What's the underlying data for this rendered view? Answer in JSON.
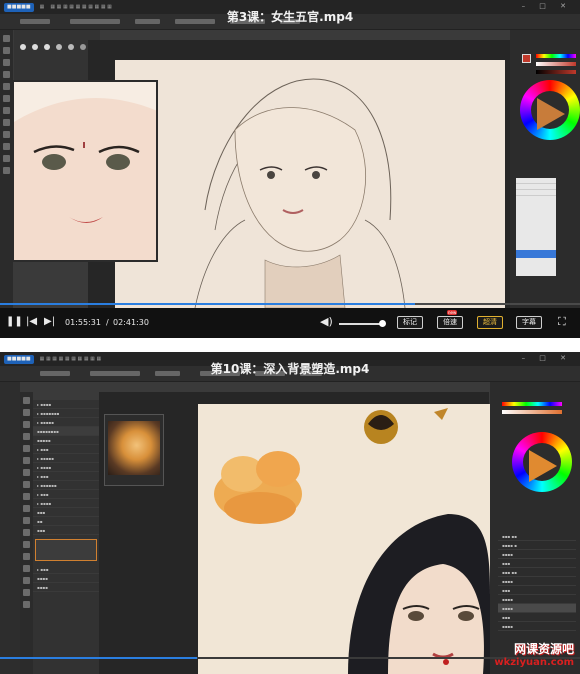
{
  "video1": {
    "title": "第3课：女生五官.mp4",
    "current_time": "01:55:31",
    "total_time": "02:41:30",
    "progress": 0.715,
    "buttons": {
      "annotate": "标记",
      "speed": "倍速",
      "quality": "超清",
      "subtitle": "字幕"
    },
    "badge_new": "new"
  },
  "video2": {
    "title": "第10课：深入背景塑造.mp4",
    "progress": 0.34,
    "watermark": "网课资源吧",
    "watermark_url": "wkziyuan.com"
  },
  "colors": {
    "progress_accent": "#2a7ee0",
    "highlight": "#f2c240",
    "canvas": "#efe4d8"
  }
}
